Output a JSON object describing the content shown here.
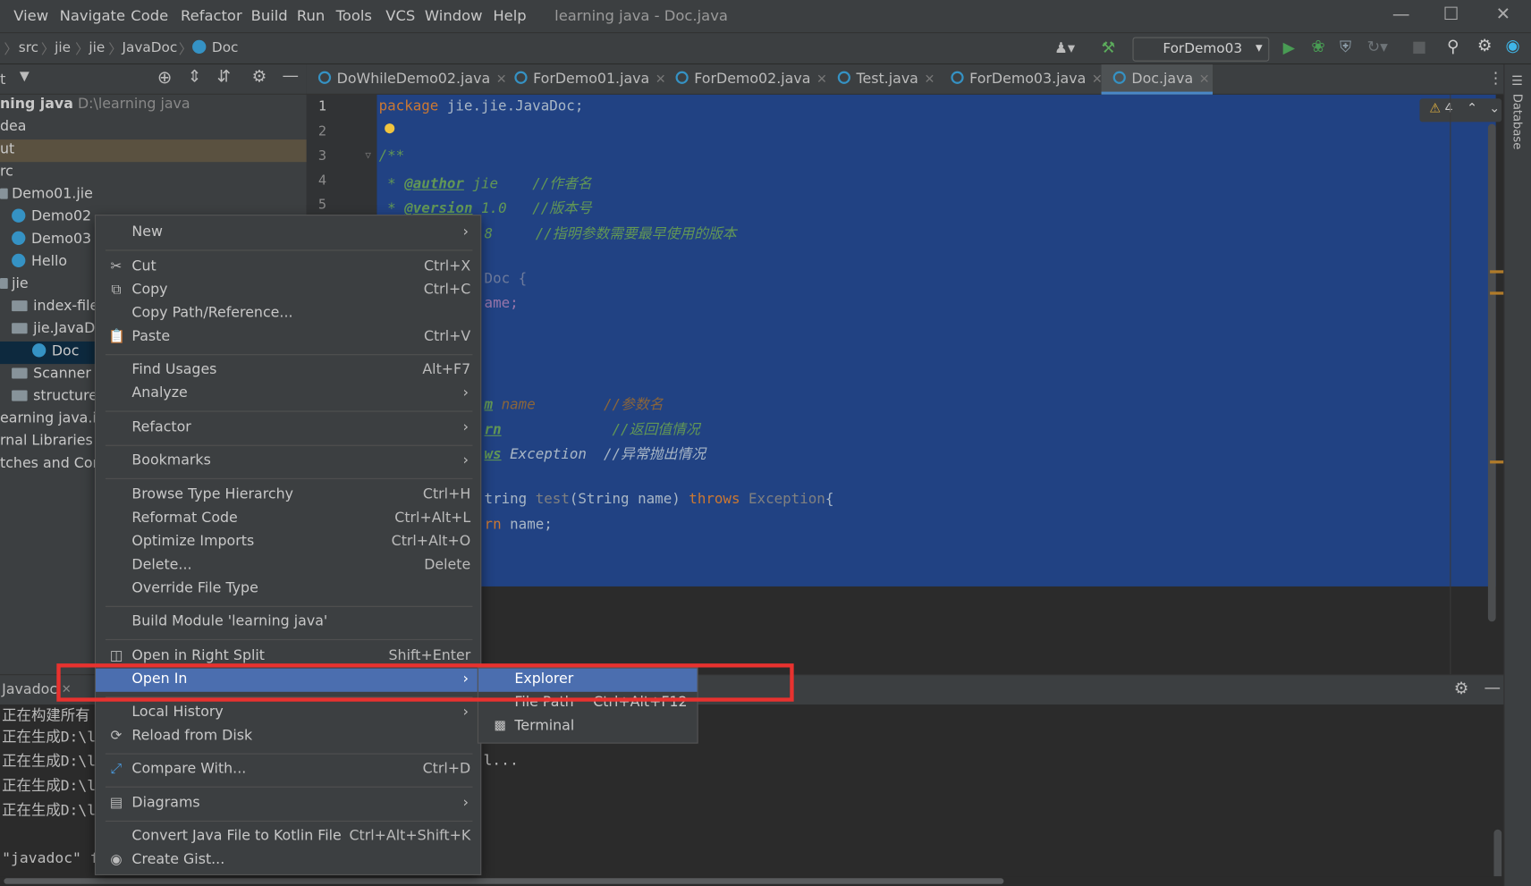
{
  "menubar": {
    "items": [
      "View",
      "Navigate",
      "Code",
      "Refactor",
      "Build",
      "Run",
      "Tools",
      "VCS",
      "Window",
      "Help"
    ],
    "title": "learning java - Doc.java"
  },
  "breadcrumb": [
    "src",
    "jie",
    "jie",
    "JavaDoc",
    "Doc"
  ],
  "run_config": "ForDemo03",
  "tabs": [
    "DoWhileDemo02.java",
    "ForDemo01.java",
    "ForDemo02.java",
    "Test.java",
    "ForDemo03.java",
    "Doc.java"
  ],
  "project_header": "t",
  "tree": [
    "ning java",
    "D:\\learning java",
    "dea",
    "ut",
    "rc",
    "Demo01.jie",
    "Demo02",
    "Demo03",
    "Hello",
    "jie",
    "index-files",
    "jie.JavaDoc",
    "Doc",
    "Scanner",
    "structure",
    "earning java.iml",
    "rnal Libraries",
    "tches and Cons"
  ],
  "gutter": [
    "1",
    "2",
    "3",
    "4",
    "5"
  ],
  "warnings": "4",
  "code": {
    "l1": [
      "package",
      " jie.jie.JavaDoc;"
    ],
    "l3": "/**",
    "l4": [
      " * ",
      "@author",
      " jie    //作者名"
    ],
    "l5": [
      " * ",
      "@version",
      " 1.0   //版本号"
    ],
    "l6": "8     //指明参数需要最早使用的版本",
    "l8": "Doc {",
    "l9": "ame;",
    "l13": [
      "m",
      " name        //参数名"
    ],
    "l14": [
      "rn",
      "             //返回值情况"
    ],
    "l15": [
      "ws",
      " Exception  //异常抛出情况"
    ],
    "l17": [
      "tring ",
      "test",
      "(String name) ",
      "throws",
      " Exception",
      "{"
    ],
    "l18": [
      "rn",
      " name;"
    ]
  },
  "database_label": "Database",
  "bottom_tab": "Javadoc",
  "console": [
    "正在构建所有",
    "正在生成D:\\l",
    "正在生成D:\\l",
    "正在生成D:\\l",
    "正在生成D:\\l",
    "\"javadoc\" f"
  ],
  "console_ellipsis": "l...",
  "context_menu": {
    "new": "New",
    "cut": "Cut",
    "cut_sc": "Ctrl+X",
    "copy": "Copy",
    "copy_sc": "Ctrl+C",
    "copy_path": "Copy Path/Reference...",
    "paste": "Paste",
    "paste_sc": "Ctrl+V",
    "find_usages": "Find Usages",
    "find_usages_sc": "Alt+F7",
    "analyze": "Analyze",
    "refactor": "Refactor",
    "bookmarks": "Bookmarks",
    "browse_hierarchy": "Browse Type Hierarchy",
    "browse_hierarchy_sc": "Ctrl+H",
    "reformat": "Reformat Code",
    "reformat_sc": "Ctrl+Alt+L",
    "optimize": "Optimize Imports",
    "optimize_sc": "Ctrl+Alt+O",
    "delete": "Delete...",
    "delete_sc": "Delete",
    "override": "Override File Type",
    "build_module": "Build Module 'learning java'",
    "open_right": "Open in Right Split",
    "open_right_sc": "Shift+Enter",
    "open_in": "Open In",
    "local_history": "Local History",
    "reload": "Reload from Disk",
    "compare": "Compare With...",
    "compare_sc": "Ctrl+D",
    "diagrams": "Diagrams",
    "convert": "Convert Java File to Kotlin File",
    "convert_sc": "Ctrl+Alt+Shift+K",
    "gist": "Create Gist..."
  },
  "submenu": {
    "explorer": "Explorer",
    "file_path": "File Path",
    "file_path_sc": "Ctrl+Alt+F12",
    "terminal": "Terminal"
  },
  "colors": {
    "selection": "#214283",
    "menu_highlight": "#4b6eaf",
    "annotation_box": "#e8322f"
  }
}
